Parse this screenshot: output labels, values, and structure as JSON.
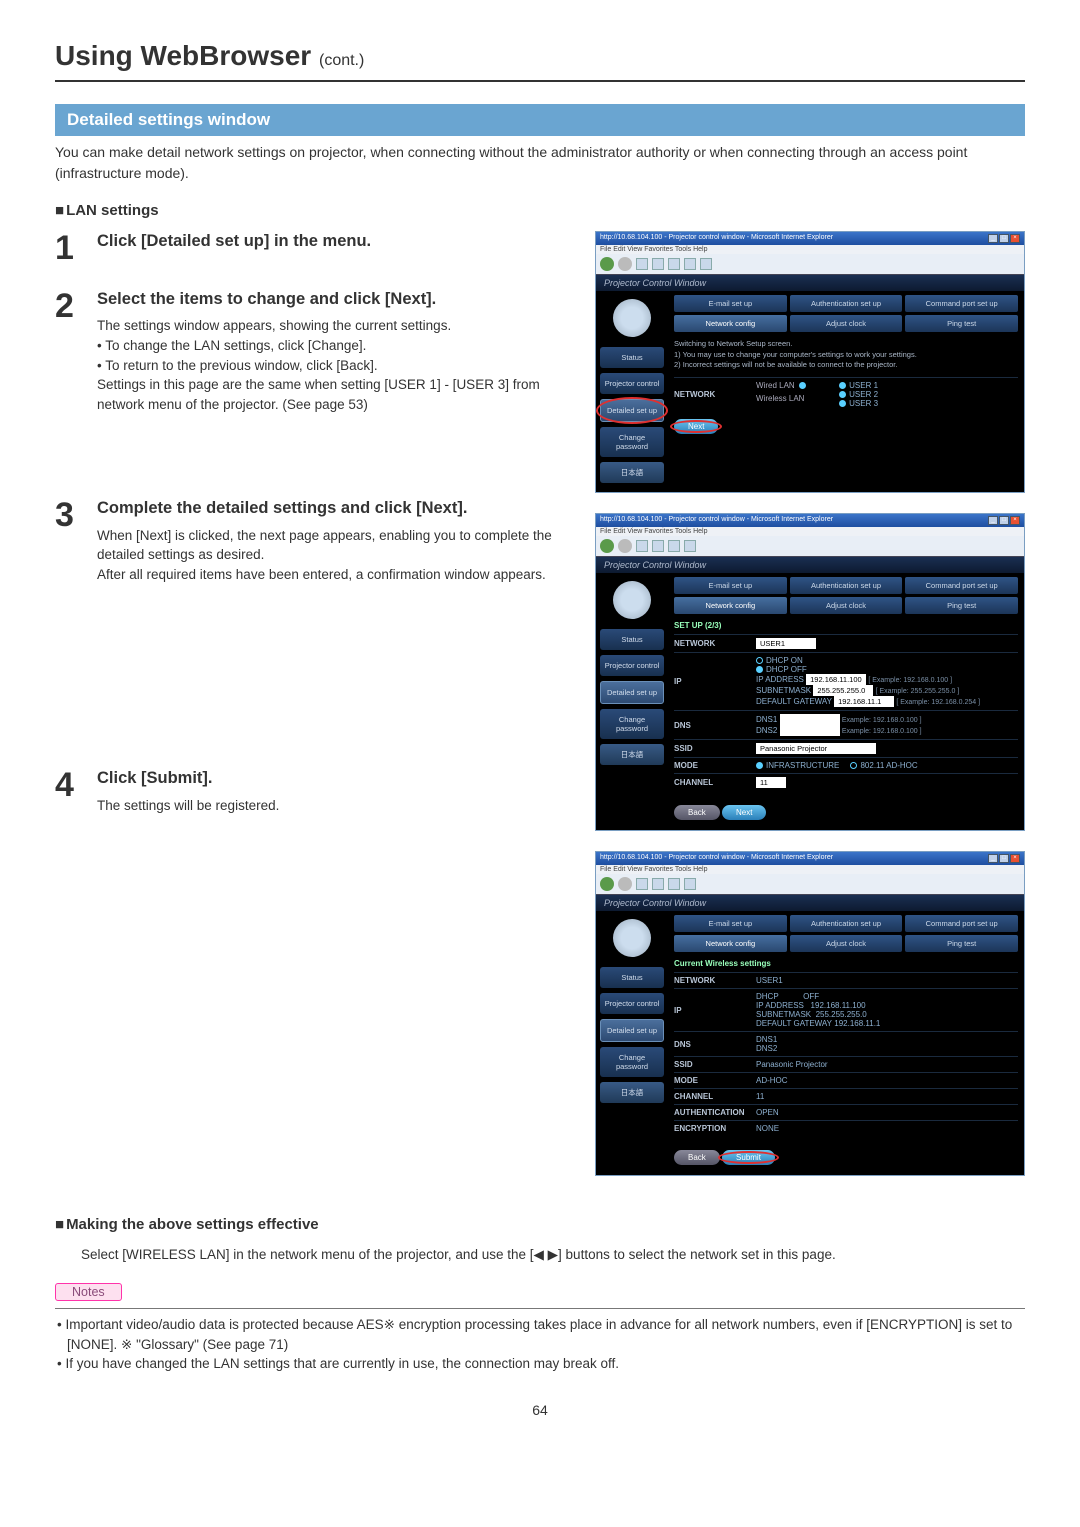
{
  "page": {
    "title": "Using WebBrowser",
    "cont": "(cont.)",
    "section": "Detailed settings window",
    "intro": "You can make detail network settings on projector, when connecting without the administrator authority or when connecting through an access point (infrastructure mode).",
    "lan_heading": "LAN settings",
    "pageNumber": "64"
  },
  "steps": {
    "s1": {
      "num": "1",
      "title": "Click [Detailed set up] in the menu."
    },
    "s2": {
      "num": "2",
      "title": "Select the items to change and click [Next].",
      "line1": "The settings window appears, showing the current settings.",
      "b1": "• To change the LAN settings, click [Change].",
      "b2": "• To return to the previous window, click [Back].",
      "line2": "Settings in this page are the same when setting [USER 1] - [USER 3] from network menu of the projector. (See page 53)"
    },
    "s3": {
      "num": "3",
      "title": "Complete the detailed settings and click [Next].",
      "line1": "When [Next] is clicked, the next page appears, enabling you to complete the detailed settings as desired.",
      "line2": "After all required items have been entered, a confirmation window appears."
    },
    "s4": {
      "num": "4",
      "title": "Click [Submit].",
      "line1": "The settings will be registered."
    }
  },
  "effective": {
    "heading": "Making the above settings effective",
    "text_a": "Select [WIRELESS LAN] in the network menu of the projector, and use the [",
    "text_b": "] buttons to select the network set in this page."
  },
  "notes": {
    "label": "Notes",
    "n1": "• Important video/audio data is protected because AES※ encryption processing takes place in advance for all network numbers, even if [ENCRYPTION] is set to [NONE]. ※ \"Glossary\" (See page 71)",
    "n2": "• If you have changed the LAN settings that are currently in use, the connection may break off."
  },
  "browser": {
    "titlebar": "http://10.68.104.100 - Projector control window - Microsoft Internet Explorer",
    "menus": "File   Edit   View   Favorites   Tools   Help",
    "header": "Projector Control Window",
    "sidebar": {
      "status": "Status",
      "proj": "Projector control",
      "detailed": "Detailed set up",
      "change": "Change password",
      "jp": "日本語"
    },
    "tabs": {
      "email": "E-mail set up",
      "auth": "Authentication set up",
      "cmd": "Command port set up",
      "net": "Network config",
      "clock": "Adjust clock",
      "ping": "Ping test"
    }
  },
  "win1": {
    "instr_head": "Switching to Network Setup screen.",
    "instr1": "1)  You may use to change your computer's settings to work your settings.",
    "instr2": "2)  Incorrect settings will not be available to connect to the projector.",
    "network": "NETWORK",
    "wired": "Wired LAN",
    "wireless": "Wireless LAN",
    "u1": "USER 1",
    "u2": "USER 2",
    "u3": "USER 3",
    "next": "Next"
  },
  "win2": {
    "setuphdr": "SET UP (2/3)",
    "network": "NETWORK",
    "networkVal": "USER1",
    "ip": "IP",
    "dhcpon": "DHCP ON",
    "dhcpoff": "DHCP OFF",
    "ipaddr_l": "IP ADDRESS",
    "ipaddr_v": "192.168.11.100",
    "ipaddr_ex": "[ Example: 192.168.0.100 ]",
    "subnet_l": "SUBNETMASK",
    "subnet_v": "255.255.255.0",
    "subnet_ex": "[ Example: 255.255.255.0 ]",
    "gw_l": "DEFAULT GATEWAY",
    "gw_v": "192.168.11.1",
    "gw_ex": "[ Example: 192.168.0.254 ]",
    "dns": "DNS",
    "dns1": "DNS1",
    "dns2": "DNS2",
    "dns_ex": "Example: 192.168.0.100 ]",
    "ssid": "SSID",
    "ssidVal": "Panasonic Projector",
    "mode": "MODE",
    "infra": "INFRASTRUCTURE",
    "adhoc": "802.11 AD-HOC",
    "channel": "CHANNEL",
    "channelVal": "11",
    "back": "Back",
    "next": "Next"
  },
  "win3": {
    "hdr": "Current Wireless settings",
    "network": "NETWORK",
    "networkVal": "USER1",
    "ip": "IP",
    "dhcp_l": "DHCP",
    "dhcp_v": "OFF",
    "ipaddr_l": "IP ADDRESS",
    "ipaddr_v": "192.168.11.100",
    "subnet_l": "SUBNETMASK",
    "subnet_v": "255.255.255.0",
    "gw_l": "DEFAULT GATEWAY",
    "gw_v": "192.168.11.1",
    "dns": "DNS",
    "dns1": "DNS1",
    "dns2": "DNS2",
    "ssid": "SSID",
    "ssidVal": "Panasonic Projector",
    "mode": "MODE",
    "modeVal": "AD-HOC",
    "channel": "CHANNEL",
    "channelVal": "11",
    "auth": "AUTHENTICATION",
    "authVal": "OPEN",
    "enc": "ENCRYPTION",
    "encVal": "NONE",
    "back": "Back",
    "submit": "Submit"
  }
}
